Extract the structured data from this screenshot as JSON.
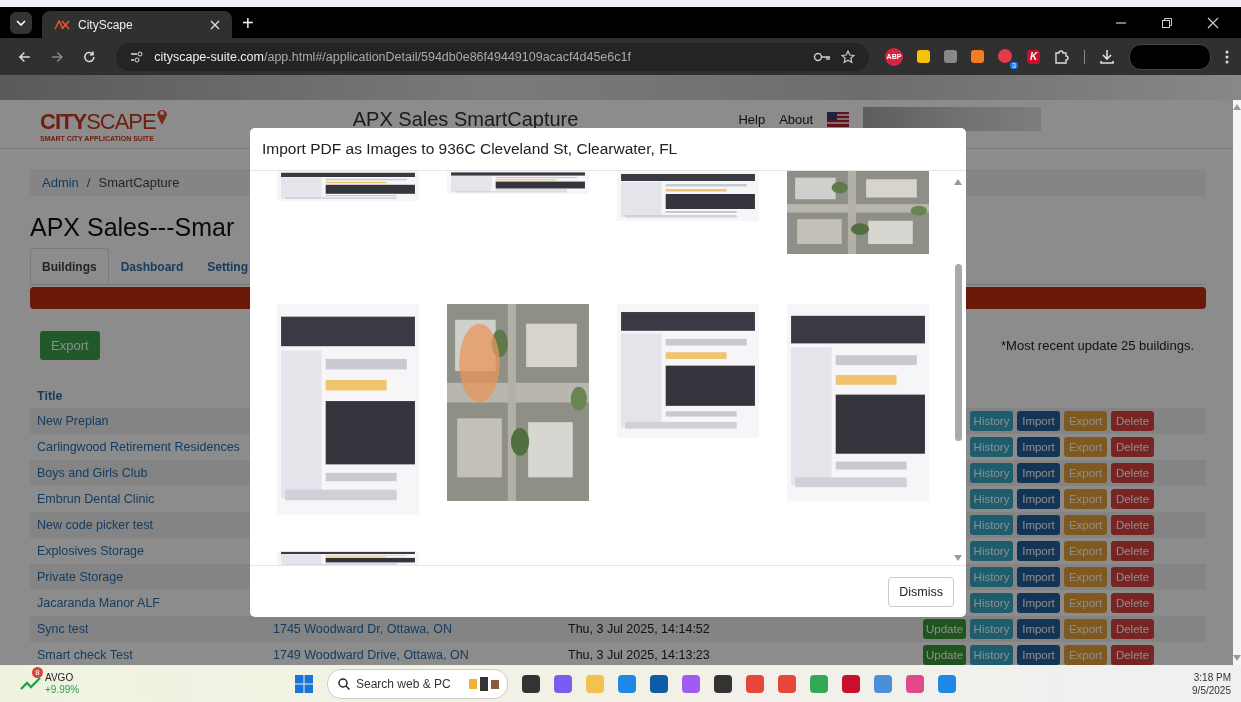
{
  "browser": {
    "tab_title": "CityScape",
    "new_tab": "+",
    "url_domain": "cityscape-suite.com",
    "url_path": "/app.html#/applicationDetail/594db0e86f49449109acacf4d45e6c1f",
    "extensions": [
      {
        "kind": "abp",
        "label": "ABP"
      },
      {
        "kind": "note"
      },
      {
        "kind": "tool"
      },
      {
        "kind": "hub"
      },
      {
        "kind": "count",
        "badge": "3"
      },
      {
        "kind": "letter",
        "label": "K"
      },
      {
        "kind": "puzzle"
      }
    ]
  },
  "header": {
    "logo_main": "CITY",
    "logo_rest": "SCAPE",
    "logo_sub": "SMART CITY APPLICATION SUITE",
    "app_title": "APX Sales SmartCapture",
    "links": [
      "Help",
      "About"
    ]
  },
  "breadcrumb": [
    "Admin",
    "SmartCapture"
  ],
  "breadcrumb_separator": "/",
  "heading": "APX Sales---Smar",
  "tabs": [
    {
      "label": "Buildings",
      "selected": true
    },
    {
      "label": "Dashboard",
      "selected": false
    },
    {
      "label": "Setting",
      "selected": false
    }
  ],
  "export_button": "Export",
  "note": "*Most recent update 25 buildings.",
  "table": {
    "columns": [
      "Title"
    ],
    "rows": [
      {
        "title": "New Preplan",
        "buttons": [
          {
            "kind": "history",
            "label": "History"
          },
          {
            "kind": "import",
            "label": "Import"
          },
          {
            "kind": "export",
            "label": "Export"
          },
          {
            "kind": "delete",
            "label": "Delete"
          }
        ]
      },
      {
        "title": "Carlingwood Retirement Residences",
        "buttons": [
          {
            "kind": "history",
            "label": "History"
          },
          {
            "kind": "import",
            "label": "Import"
          },
          {
            "kind": "export",
            "label": "Export"
          },
          {
            "kind": "delete",
            "label": "Delete"
          }
        ]
      },
      {
        "title": "Boys and Girls Club",
        "buttons": [
          {
            "kind": "history",
            "label": "History"
          },
          {
            "kind": "import",
            "label": "Import"
          },
          {
            "kind": "export",
            "label": "Export"
          },
          {
            "kind": "delete",
            "label": "Delete"
          }
        ]
      },
      {
        "title": "Embrun Dental Clinic",
        "buttons": [
          {
            "kind": "history",
            "label": "History"
          },
          {
            "kind": "import",
            "label": "Import"
          },
          {
            "kind": "export",
            "label": "Export"
          },
          {
            "kind": "delete",
            "label": "Delete"
          }
        ]
      },
      {
        "title": "New code picker test",
        "buttons": [
          {
            "kind": "history",
            "label": "History"
          },
          {
            "kind": "import",
            "label": "Import"
          },
          {
            "kind": "export",
            "label": "Export"
          },
          {
            "kind": "delete",
            "label": "Delete"
          }
        ]
      },
      {
        "title": "Explosives Storage",
        "buttons": [
          {
            "kind": "history",
            "label": "History"
          },
          {
            "kind": "import",
            "label": "Import"
          },
          {
            "kind": "export",
            "label": "Export"
          },
          {
            "kind": "delete",
            "label": "Delete"
          }
        ]
      },
      {
        "title": "Private Storage",
        "buttons": [
          {
            "kind": "history",
            "label": "History"
          },
          {
            "kind": "import",
            "label": "Import"
          },
          {
            "kind": "export",
            "label": "Export"
          },
          {
            "kind": "delete",
            "label": "Delete"
          }
        ]
      },
      {
        "title": "Jacaranda Manor ALF",
        "buttons": [
          {
            "kind": "history",
            "label": "History"
          },
          {
            "kind": "import",
            "label": "Import"
          },
          {
            "kind": "export",
            "label": "Export"
          },
          {
            "kind": "delete",
            "label": "Delete"
          }
        ]
      },
      {
        "title": "Sync test",
        "address": "1745 Woodward Dr, Ottawa, ON",
        "date": "Thu, 3 Jul 2025, 14:14:52",
        "buttons": [
          {
            "kind": "update",
            "label": "Update"
          },
          {
            "kind": "history",
            "label": "History"
          },
          {
            "kind": "import",
            "label": "Import"
          },
          {
            "kind": "export",
            "label": "Export"
          },
          {
            "kind": "delete",
            "label": "Delete"
          }
        ]
      },
      {
        "title": "Smart check Test",
        "address": "1749 Woodward Drive, Ottawa, ON",
        "date": "Thu, 3 Jul 2025, 14:13:23",
        "buttons": [
          {
            "kind": "update",
            "label": "Update"
          },
          {
            "kind": "history",
            "label": "History"
          },
          {
            "kind": "import",
            "label": "Import"
          },
          {
            "kind": "export",
            "label": "Export"
          },
          {
            "kind": "delete",
            "label": "Delete"
          }
        ]
      }
    ]
  },
  "modal": {
    "title": "Import PDF as Images to 936C Cleveland St, Clearwater, FL",
    "dismiss": "Dismiss"
  },
  "taskbar": {
    "stock": {
      "symbol": "AVGO",
      "change": "+9.99%",
      "badge": "8"
    },
    "search_placeholder": "Search web & PC",
    "time": "3:18 PM",
    "date": "9/5/2025"
  }
}
